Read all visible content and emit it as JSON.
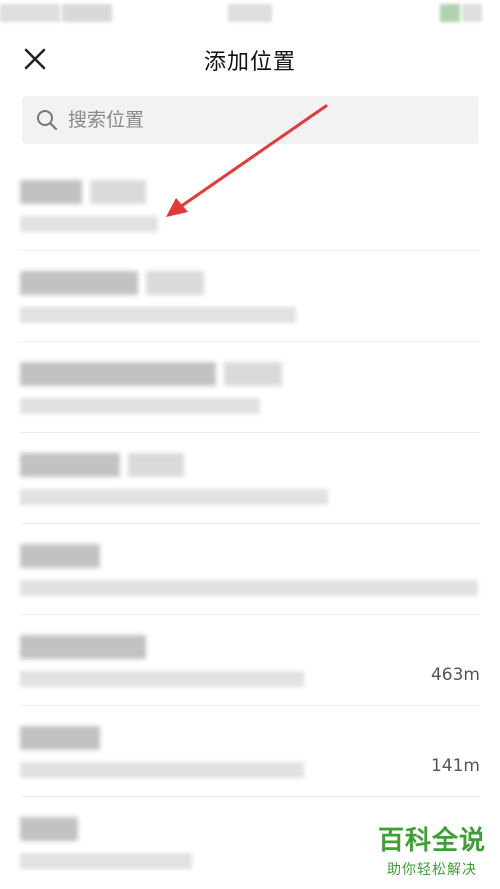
{
  "header": {
    "title": "添加位置"
  },
  "search": {
    "placeholder": "搜索位置",
    "value": ""
  },
  "locations": [
    {
      "distance": ""
    },
    {
      "distance": ""
    },
    {
      "distance": ""
    },
    {
      "distance": ""
    },
    {
      "distance": ""
    },
    {
      "distance": "463m"
    },
    {
      "distance": "141m"
    },
    {
      "distance": ""
    }
  ],
  "annotation": {
    "arrow_color": "#e53935"
  },
  "watermark": {
    "main": "百科全说",
    "sub": "助你轻松解决",
    "color": "#3ea034"
  }
}
